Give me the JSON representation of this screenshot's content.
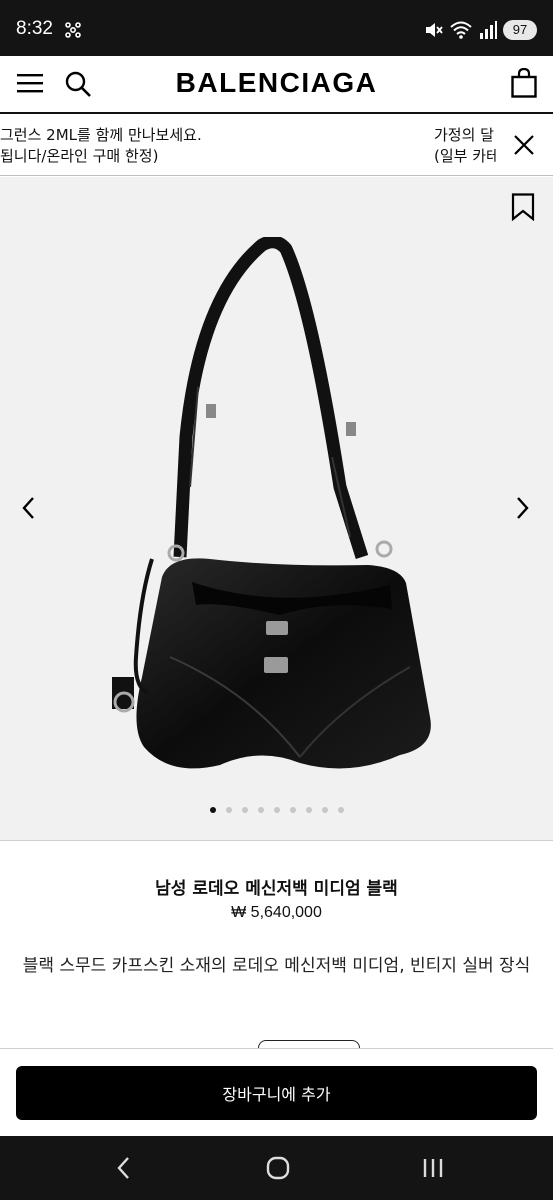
{
  "status_bar": {
    "time": "8:32",
    "battery": "97"
  },
  "header": {
    "brand": "BALENCIAGA"
  },
  "promo": {
    "left_line1": "그런스 2ML를 함께 만나보세요.",
    "left_line2": "됩니다/온라인 구매 한정)",
    "right_line1": "가정의 달",
    "right_line2": "(일부 카테"
  },
  "gallery": {
    "slide_count": 9,
    "active_index": 0
  },
  "product": {
    "title": "남성 로데오 메신저백 미디엄 블랙",
    "price": "₩ 5,640,000",
    "description": "블랙 스무드 카프스킨 소재의 로데오 메신저백 미디엄, 빈티지 실버 장식"
  },
  "cart": {
    "button_label": "장바구니에 추가"
  },
  "colors": {
    "system_bar": "#141414",
    "primary": "#000000",
    "gallery_bg": "#f1f1f1"
  }
}
